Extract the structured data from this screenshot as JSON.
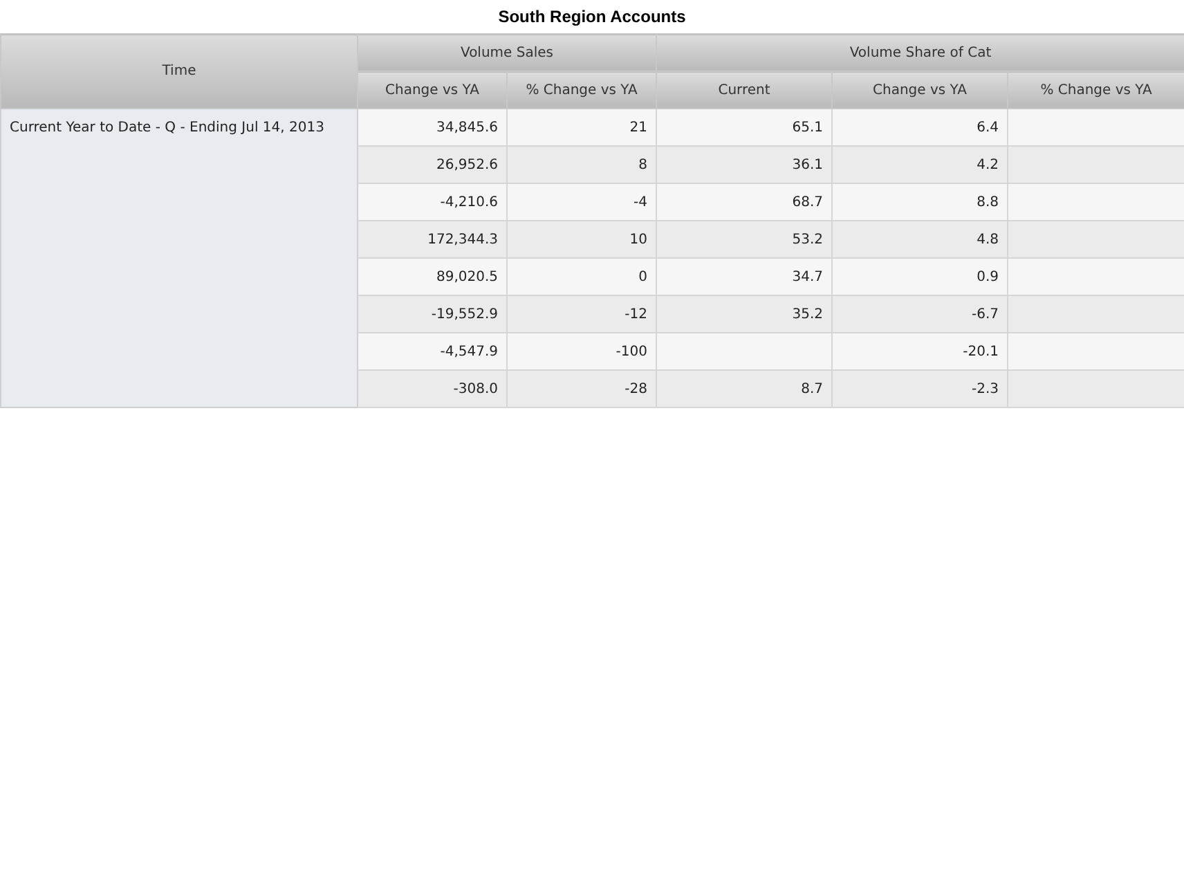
{
  "title": "South Region Accounts",
  "header": {
    "row_label": "Time",
    "groups": [
      {
        "label": "Volume Sales",
        "columns": [
          "Change vs YA",
          "% Change vs YA"
        ]
      },
      {
        "label": "Volume Share of Cat",
        "columns": [
          "Current",
          "Change vs YA",
          "% Change vs YA"
        ]
      }
    ]
  },
  "time_period": "Current Year to Date - Q - Ending Jul 14, 2013",
  "rows": [
    {
      "cells": [
        "34,845.6",
        "21",
        "65.1",
        "6.4",
        null
      ]
    },
    {
      "cells": [
        "26,952.6",
        "8",
        "36.1",
        "4.2",
        null
      ]
    },
    {
      "cells": [
        "-4,210.6",
        "-4",
        "68.7",
        "8.8",
        null
      ]
    },
    {
      "cells": [
        "172,344.3",
        "10",
        "53.2",
        "4.8",
        null
      ]
    },
    {
      "cells": [
        "89,020.5",
        "0",
        "34.7",
        "0.9",
        null
      ]
    },
    {
      "cells": [
        "-19,552.9",
        "-12",
        "35.2",
        "-6.7",
        null
      ]
    },
    {
      "cells": [
        "-4,547.9",
        "-100",
        null,
        "-20.1",
        null
      ]
    },
    {
      "cells": [
        "-308.0",
        "-28",
        "8.7",
        "-2.3",
        null
      ]
    }
  ]
}
